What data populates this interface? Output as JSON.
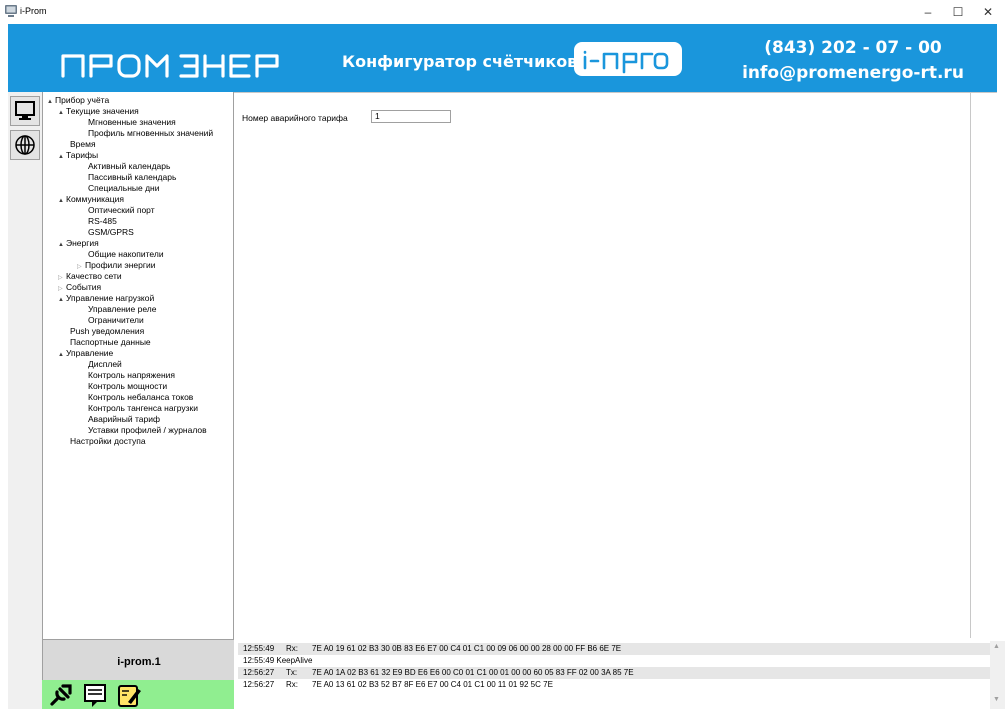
{
  "window": {
    "title": "i-Prom",
    "minimize": "–",
    "maximize": "☐",
    "close": "✕"
  },
  "header": {
    "logo_text": "пром энерго",
    "subtitle": "Конфигуратор счётчиков",
    "badge": "i-prom",
    "phone": "(843) 202 - 07 - 00",
    "email": "info@promenergo-rt.ru",
    "colors": {
      "header_bg": "#1a96dc",
      "tools_bg": "#90ee90"
    }
  },
  "leftbar": {
    "icons": [
      "monitor-icon",
      "globe-icon"
    ]
  },
  "tree": [
    {
      "label": "Прибор учёта",
      "expander": "▲"
    },
    {
      "label": "Текущие значения",
      "expander": "▲"
    },
    {
      "label": "Мгновенные значения",
      "expander": ""
    },
    {
      "label": "Профиль мгновенных значений",
      "expander": ""
    },
    {
      "label": "Время",
      "expander": ""
    },
    {
      "label": "Тарифы",
      "expander": "▲"
    },
    {
      "label": "Активный календарь",
      "expander": ""
    },
    {
      "label": "Пассивный календарь",
      "expander": ""
    },
    {
      "label": "Специальные дни",
      "expander": ""
    },
    {
      "label": "Коммуникация",
      "expander": "▲"
    },
    {
      "label": "Оптический порт",
      "expander": ""
    },
    {
      "label": "RS-485",
      "expander": ""
    },
    {
      "label": "GSM/GPRS",
      "expander": ""
    },
    {
      "label": "Энергия",
      "expander": "▲"
    },
    {
      "label": "Общие накопители",
      "expander": ""
    },
    {
      "label": "Профили энергии",
      "expander": "▷"
    },
    {
      "label": "Качество сети",
      "expander": "▷"
    },
    {
      "label": "События",
      "expander": "▷"
    },
    {
      "label": "Управление нагрузкой",
      "expander": "▲"
    },
    {
      "label": "Управление реле",
      "expander": ""
    },
    {
      "label": "Ограничители",
      "expander": ""
    },
    {
      "label": "Push уведомления",
      "expander": ""
    },
    {
      "label": "Паспортные данные",
      "expander": ""
    },
    {
      "label": "Управление",
      "expander": "▲"
    },
    {
      "label": "Дисплей",
      "expander": ""
    },
    {
      "label": "Контроль напряжения",
      "expander": ""
    },
    {
      "label": "Контроль мощности",
      "expander": ""
    },
    {
      "label": "Контроль небаланса токов",
      "expander": ""
    },
    {
      "label": "Контроль тангенса нагрузки",
      "expander": ""
    },
    {
      "label": "Аварийный тариф",
      "expander": ""
    },
    {
      "label": "Уставки профилей / журналов",
      "expander": ""
    },
    {
      "label": "Настройки доступа",
      "expander": ""
    }
  ],
  "device": {
    "name": "i-prom.1"
  },
  "tools": {
    "icons": [
      "connect-icon",
      "card-icon",
      "edit-icon"
    ]
  },
  "content": {
    "field_label": "Номер аварийного тарифа",
    "field_value": "1"
  },
  "log": [
    {
      "time": "12:55:49",
      "dir": "Rx:",
      "msg": "7E A0 19 61 02 B3 30 0B 83 E6 E7 00 C4 01 C1 00 09 06 00 00 28 00 00 FF B6 6E 7E"
    },
    {
      "time": "",
      "dir": "",
      "msg": "12:55:49 KeepAlive"
    },
    {
      "time": "12:56:27",
      "dir": "Tx:",
      "msg": "7E A0 1A 02 B3 61 32 E9 BD E6 E6 00 C0 01 C1 00 01 00 00 60 05 83 FF 02 00 3A 85 7E"
    },
    {
      "time": "12:56:27",
      "dir": "Rx:",
      "msg": "7E A0 13 61 02 B3 52 B7 8F E6 E7 00 C4 01 C1 00 11 01 92 5C 7E"
    }
  ]
}
